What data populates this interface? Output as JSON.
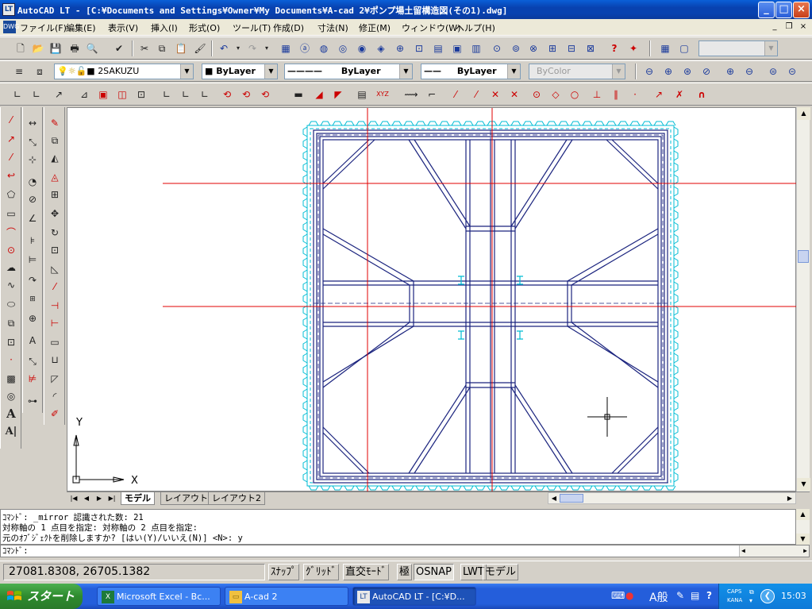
{
  "window": {
    "title": "AutoCAD LT - [C:¥Documents and Settings¥Owner¥My Documents¥A-cad 2¥ポンプ場土留構造図(その1).dwg]",
    "app_icon": "autocad-icon"
  },
  "menu": {
    "items": [
      "ファイル(F)",
      "編集(E)",
      "表示(V)",
      "挿入(I)",
      "形式(O)",
      "ツール(T)",
      "作成(D)",
      "寸法(N)",
      "修正(M)",
      "ウィンドウ(W)",
      "ヘルプ(H)"
    ]
  },
  "layer_toolbar": {
    "layer": "2SAKUZU",
    "color": "ByLayer",
    "linetype": "ByLayer",
    "lineweight": "ByLayer",
    "plotstyle": "ByColor"
  },
  "axes": {
    "y": "Y",
    "x": "X"
  },
  "tabs": [
    {
      "label": "モデル",
      "active": true
    },
    {
      "label": "レイアウト1",
      "active": false
    },
    {
      "label": "レイアウト2",
      "active": false
    }
  ],
  "command_history": [
    "ｺﾏﾝﾄﾞ: _mirror 認識された数: 21",
    "対称軸の 1 点目を指定: 対称軸の 2 点目を指定:",
    "元のｵﾌﾞｼﾞｪｸﾄを削除しますか? [はい(Y)/いいえ(N)] <N>: y"
  ],
  "command_prompt": "ｺﾏﾝﾄﾞ:",
  "status": {
    "coords": "27081.8308, 26705.1382",
    "buttons": [
      {
        "label": "ｽﾅｯﾌﾟ",
        "on": false
      },
      {
        "label": "ｸﾞﾘｯﾄﾞ",
        "on": false
      },
      {
        "label": "直交ﾓｰﾄﾞ",
        "on": false
      },
      {
        "label": "極",
        "on": false
      },
      {
        "label": "OSNAP",
        "on": true
      },
      {
        "label": "LWT",
        "on": false
      },
      {
        "label": "モデル",
        "on": false
      }
    ]
  },
  "taskbar": {
    "start": "スタート",
    "tasks": [
      {
        "label": "Microsoft Excel - Bc...",
        "icon": "excel-icon",
        "active": false
      },
      {
        "label": "A-cad 2",
        "icon": "folder-icon",
        "active": false
      },
      {
        "label": "AutoCAD LT - [C:¥D...",
        "icon": "autocad-icon",
        "active": true
      }
    ],
    "tray": {
      "ime": "A般",
      "caps": "CAPS",
      "kana": "KANA",
      "time": "15:03"
    }
  },
  "colors": {
    "cad_line": "#1a237e",
    "cad_red": "#e00000",
    "cad_cyan": "#00bcd4",
    "titlebar": "#0842b0"
  }
}
